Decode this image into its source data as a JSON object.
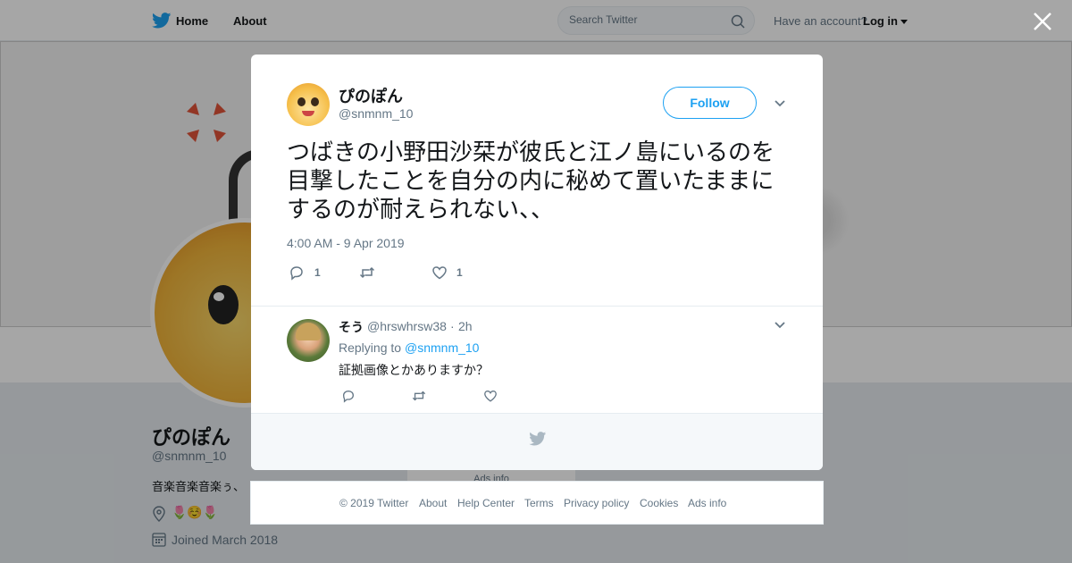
{
  "topnav": {
    "home_label": "Home",
    "about_label": "About",
    "search_placeholder": "Search Twitter",
    "have_account": "Have an account?",
    "login_label": "Log in",
    "brand_color": "#1da1f2"
  },
  "profile": {
    "name": "ぴのぽん",
    "handle": "@snmnm_10",
    "bio": "音楽音楽音楽ぅ、",
    "location": "🌷☺️🌷",
    "joined": "Joined March 2018",
    "ads_info": "Ads info"
  },
  "tweet": {
    "author_name": "ぴのぽん",
    "author_handle": "@snmnm_10",
    "follow_label": "Follow",
    "text": "つばきの小野田沙栞が彼氏と江ノ島にいるのを目撃したことを自分の内に秘めて置いたままにするのが耐えられない、、",
    "timestamp": "4:00 AM - 9 Apr 2019",
    "reply_count": "1",
    "like_count": "1"
  },
  "reply": {
    "author_name": "そう",
    "author_handle": "@hrswhrsw38",
    "separator": "·",
    "time": "2h",
    "replying_to_label": "Replying to",
    "replying_to_handle": "@snmnm_10",
    "text": "証拠画像とかありますか？"
  },
  "footer": {
    "links": [
      "© 2019 Twitter",
      "About",
      "Help Center",
      "Terms",
      "Privacy policy",
      "Cookies",
      "Ads info"
    ]
  },
  "icons": {
    "close": "close-icon",
    "search": "search-icon",
    "reply": "reply-icon",
    "retweet": "retweet-icon",
    "like": "heart-icon",
    "bird": "twitter-bird-icon"
  }
}
